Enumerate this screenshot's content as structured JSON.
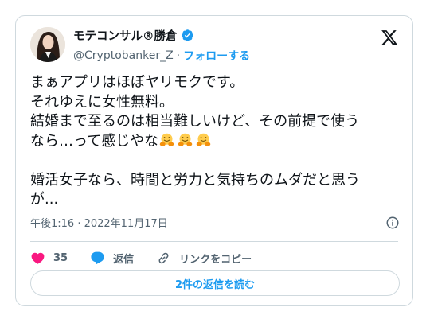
{
  "author": {
    "name": "モテコンサル®勝倉",
    "handle": "@Cryptobanker_Z",
    "separator": "·",
    "follow_label": "フォローする",
    "verified": true
  },
  "tweet": {
    "lines": [
      "まぁアプリはほぼヤリモクです。",
      "それゆえに女性無料。",
      "結婚まで至るのは相当難しいけど、その前提で使う",
      "なら…って感じやな",
      "",
      "婚活女子なら、時間と労力と気持ちのムダだと思う",
      "が..."
    ],
    "emoji": [
      "hugging-face",
      "hugging-face",
      "hugging-face"
    ],
    "timestamp": "午後1:16 · 2022年11月17日"
  },
  "actions": {
    "like_count": "35",
    "reply_label": "返信",
    "copy_link_label": "リンクをコピー"
  },
  "read_replies_label": "2件の返信を読む",
  "colors": {
    "accent": "#1d9bf0",
    "like": "#f91880",
    "text": "#0f1419",
    "muted": "#536471",
    "border": "#cfd9de"
  }
}
